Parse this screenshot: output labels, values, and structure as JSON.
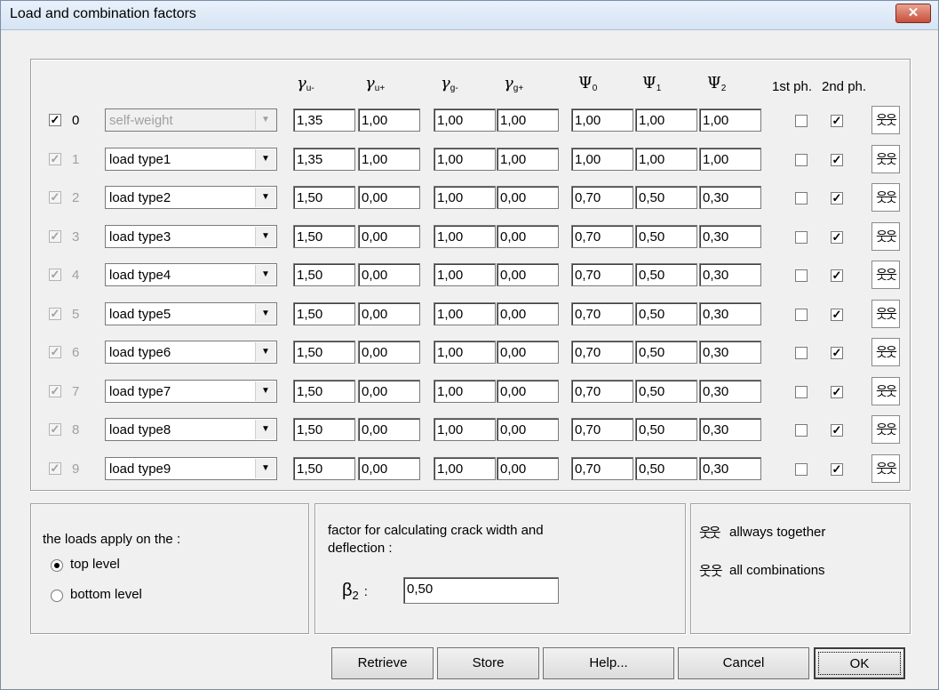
{
  "window": {
    "title": "Load and combination factors",
    "close_label": "✕"
  },
  "headers": {
    "gamma_u_minus": {
      "sym": "γ",
      "sub": "u-"
    },
    "gamma_u_plus": {
      "sym": "γ",
      "sub": "u+"
    },
    "gamma_g_minus": {
      "sym": "γ",
      "sub": "g-"
    },
    "gamma_g_plus": {
      "sym": "γ",
      "sub": "g+"
    },
    "psi0": {
      "sym": "Ψ",
      "sub": "0"
    },
    "psi1": {
      "sym": "Ψ",
      "sub": "1"
    },
    "psi2": {
      "sym": "Ψ",
      "sub": "2"
    },
    "phase1": "1st ph.",
    "phase2": "2nd ph."
  },
  "rows": [
    {
      "num": "0",
      "name": "self-weight",
      "gu_minus": "1,35",
      "gu_plus": "1,00",
      "gg_minus": "1,00",
      "gg_plus": "1,00",
      "psi0": "1,00",
      "psi1": "1,00",
      "psi2": "1,00"
    },
    {
      "num": "1",
      "name": "load type1",
      "gu_minus": "1,35",
      "gu_plus": "1,00",
      "gg_minus": "1,00",
      "gg_plus": "1,00",
      "psi0": "1,00",
      "psi1": "1,00",
      "psi2": "1,00"
    },
    {
      "num": "2",
      "name": "load type2",
      "gu_minus": "1,50",
      "gu_plus": "0,00",
      "gg_minus": "1,00",
      "gg_plus": "0,00",
      "psi0": "0,70",
      "psi1": "0,50",
      "psi2": "0,30"
    },
    {
      "num": "3",
      "name": "load type3",
      "gu_minus": "1,50",
      "gu_plus": "0,00",
      "gg_minus": "1,00",
      "gg_plus": "0,00",
      "psi0": "0,70",
      "psi1": "0,50",
      "psi2": "0,30"
    },
    {
      "num": "4",
      "name": "load type4",
      "gu_minus": "1,50",
      "gu_plus": "0,00",
      "gg_minus": "1,00",
      "gg_plus": "0,00",
      "psi0": "0,70",
      "psi1": "0,50",
      "psi2": "0,30"
    },
    {
      "num": "5",
      "name": "load type5",
      "gu_minus": "1,50",
      "gu_plus": "0,00",
      "gg_minus": "1,00",
      "gg_plus": "0,00",
      "psi0": "0,70",
      "psi1": "0,50",
      "psi2": "0,30"
    },
    {
      "num": "6",
      "name": "load type6",
      "gu_minus": "1,50",
      "gu_plus": "0,00",
      "gg_minus": "1,00",
      "gg_plus": "0,00",
      "psi0": "0,70",
      "psi1": "0,50",
      "psi2": "0,30"
    },
    {
      "num": "7",
      "name": "load type7",
      "gu_minus": "1,50",
      "gu_plus": "0,00",
      "gg_minus": "1,00",
      "gg_plus": "0,00",
      "psi0": "0,70",
      "psi1": "0,50",
      "psi2": "0,30"
    },
    {
      "num": "8",
      "name": "load type8",
      "gu_minus": "1,50",
      "gu_plus": "0,00",
      "gg_minus": "1,00",
      "gg_plus": "0,00",
      "psi0": "0,70",
      "psi1": "0,50",
      "psi2": "0,30"
    },
    {
      "num": "9",
      "name": "load type9",
      "gu_minus": "1,50",
      "gu_plus": "0,00",
      "gg_minus": "1,00",
      "gg_plus": "0,00",
      "psi0": "0,70",
      "psi1": "0,50",
      "psi2": "0,30"
    }
  ],
  "checks": {
    "mark": "✓"
  },
  "combo_arrow": "▼",
  "combo_icon": "웃웃",
  "apply": {
    "title": "the loads apply on the :",
    "options": [
      "top level",
      "bottom level"
    ],
    "selected": "top level"
  },
  "crack": {
    "text1": "factor for calculating crack width and",
    "text2": "deflection :",
    "beta_sym": "β",
    "beta_sub": "2",
    "beta_suffix": ":",
    "beta_value": "0,50"
  },
  "legend": {
    "together": "allways together",
    "all": "all combinations"
  },
  "buttons": {
    "retrieve": "Retrieve",
    "store": "Store",
    "help": "Help...",
    "cancel": "Cancel",
    "ok": "OK"
  }
}
